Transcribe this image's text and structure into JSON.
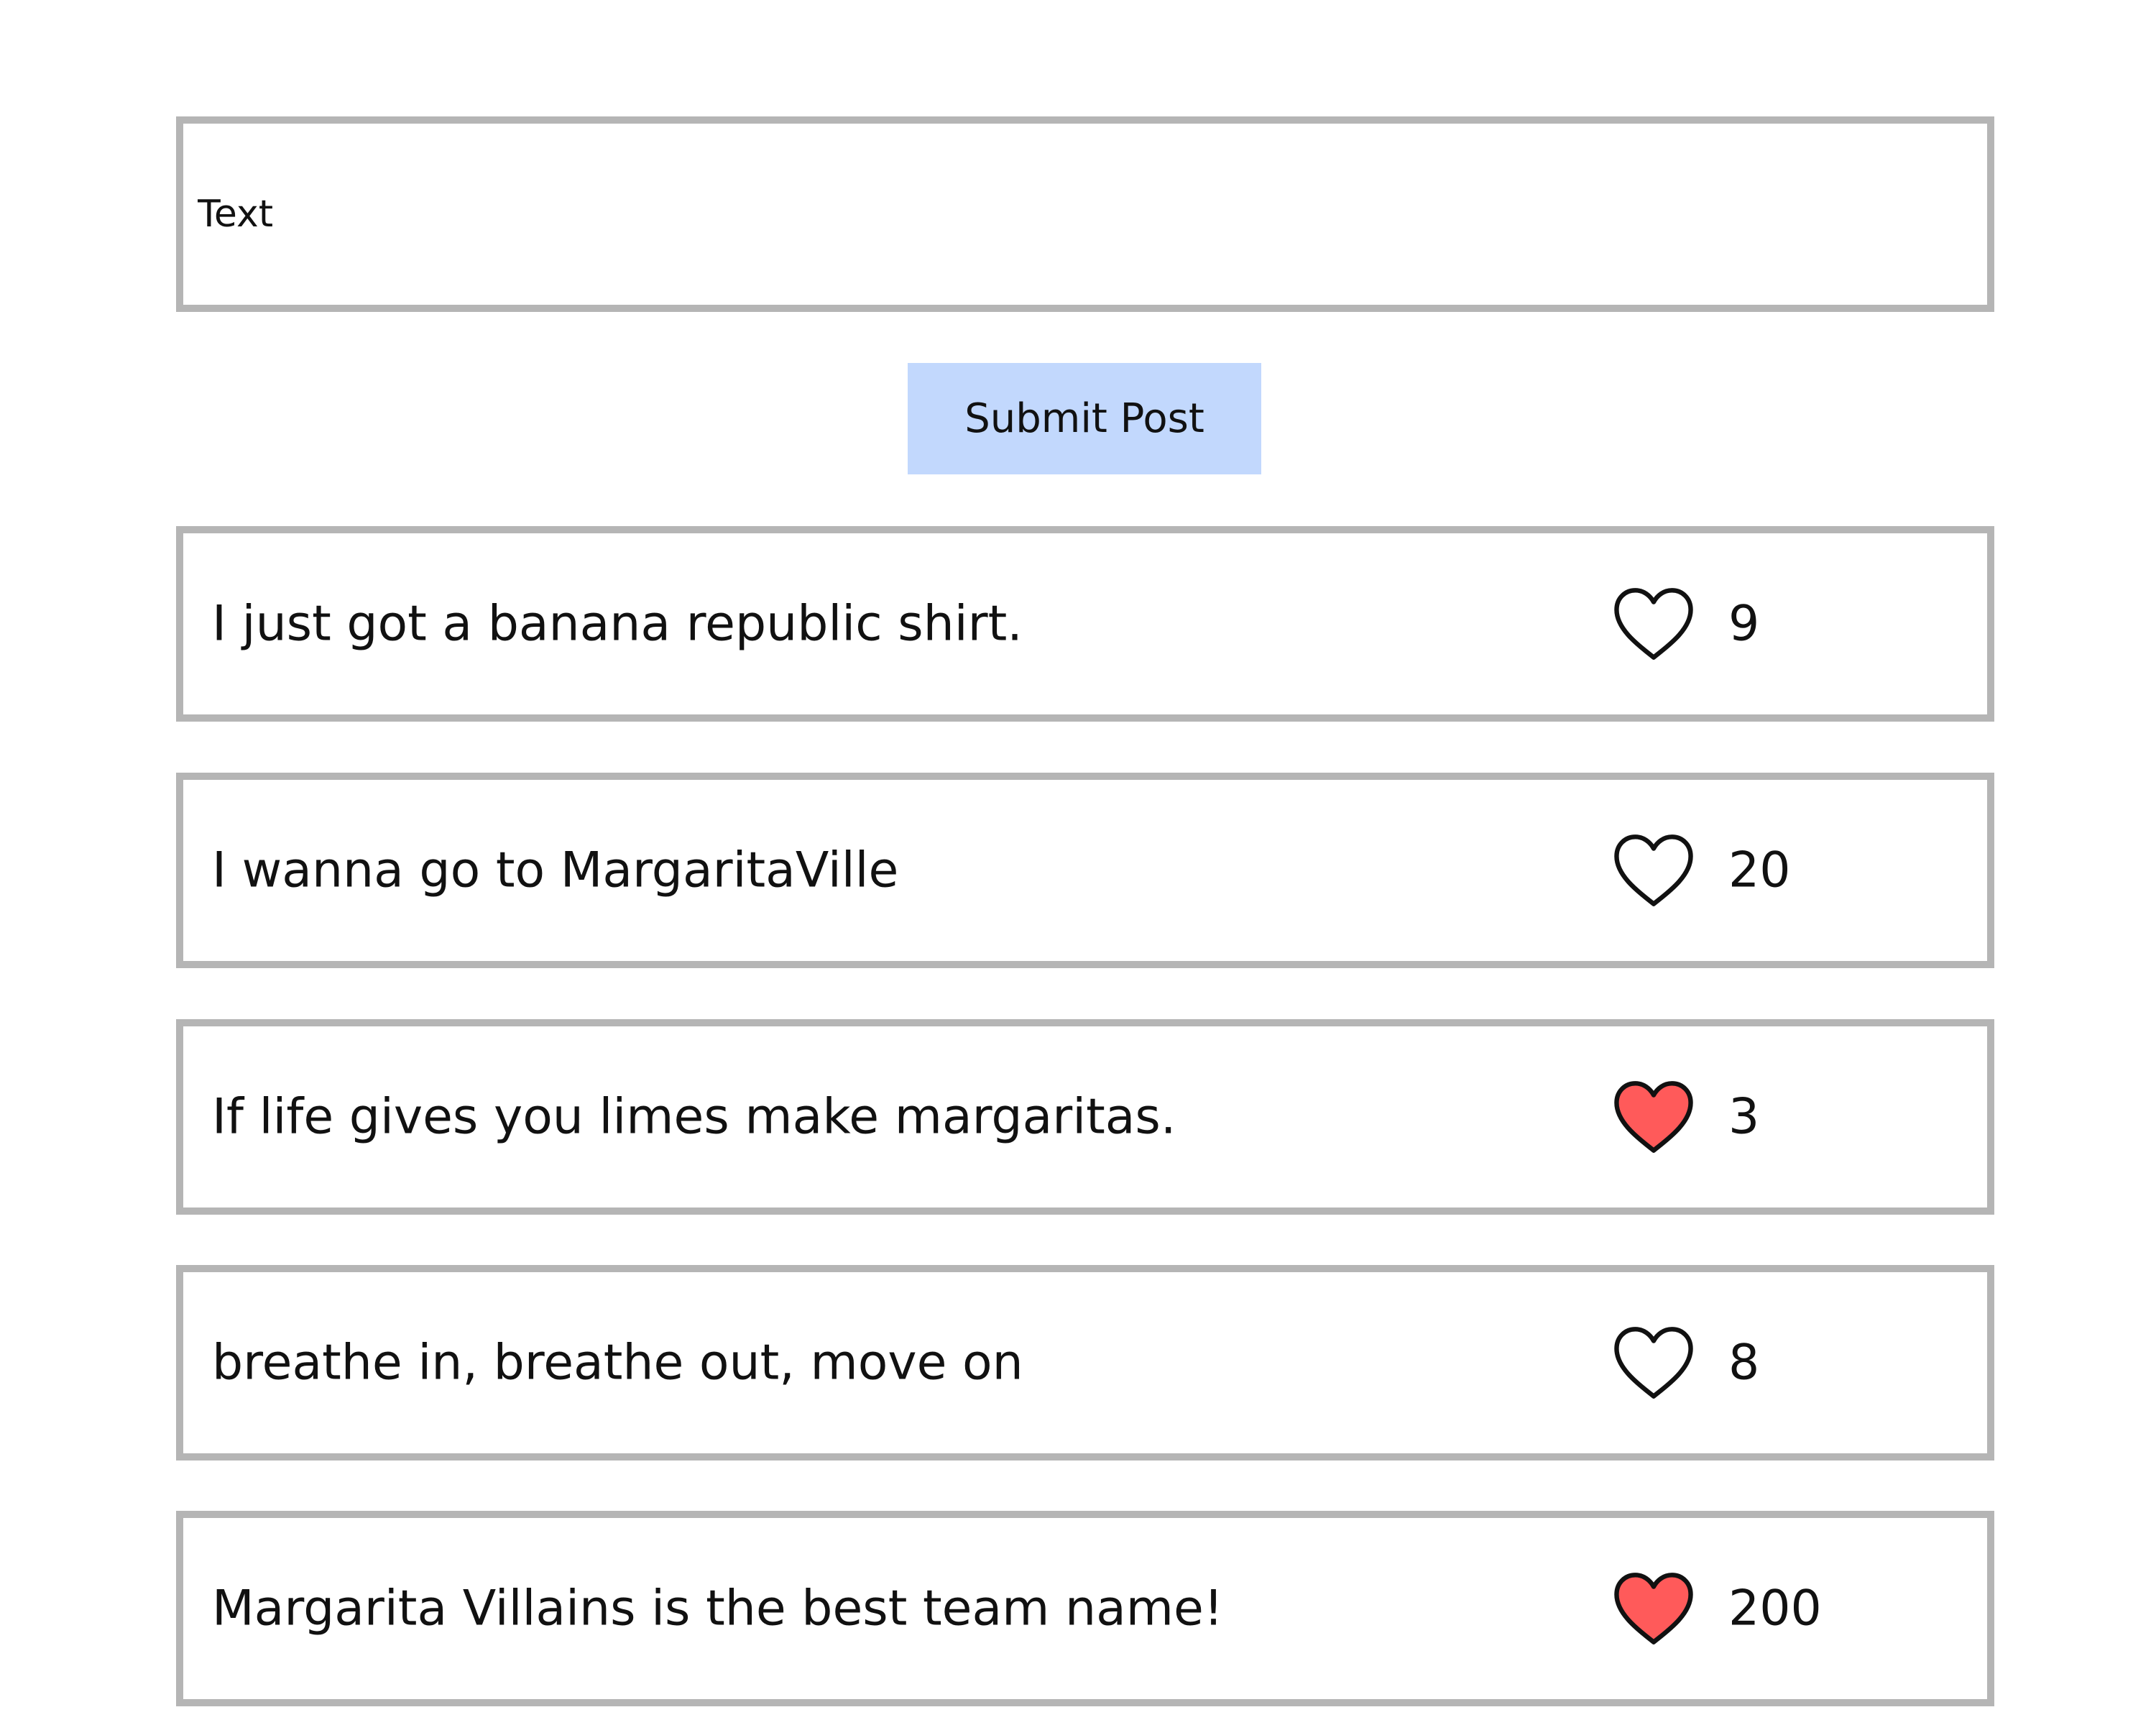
{
  "composer": {
    "placeholder": "Text",
    "value": ""
  },
  "submit_label": "Submit Post",
  "posts": [
    {
      "text": "I just got a banana republic shirt.",
      "likes": "9",
      "liked": false
    },
    {
      "text": "I wanna go to MargaritaVille",
      "likes": "20",
      "liked": false
    },
    {
      "text": "If life gives you limes make margaritas.",
      "likes": "3",
      "liked": true
    },
    {
      "text": "breathe in, breathe out, move on",
      "likes": "8",
      "liked": false
    },
    {
      "text": "Margarita Villains is the best team name!",
      "likes": "200",
      "liked": true
    }
  ],
  "colors": {
    "liked_heart": "#ff5a5a",
    "border": "#b5b5b5",
    "button_bg": "#c2d8fd"
  },
  "icons": {
    "heart": "heart-icon"
  }
}
